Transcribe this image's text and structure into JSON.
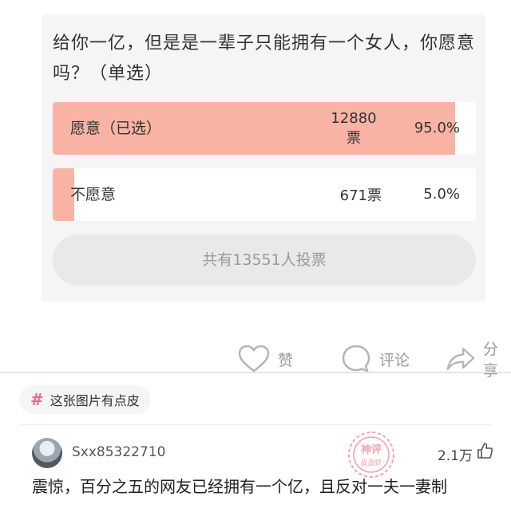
{
  "poll": {
    "question": "给你一亿，但是是一辈子只能拥有一个女人，你愿意吗？（单选）",
    "options": [
      {
        "label": "愿意（已选）",
        "votes": "12880票",
        "percent": "95.0%",
        "fill_fraction": 0.95
      },
      {
        "label": "不愿意",
        "votes": "671票",
        "percent": "5.0%",
        "fill_fraction": 0.05
      }
    ],
    "total": "共有13551人投票"
  },
  "actions": {
    "like_label": "赞",
    "comment_label": "评论",
    "share_label": "分享"
  },
  "tag": {
    "symbol": "#",
    "text": "这张图片有点皮"
  },
  "comment": {
    "username": "Sxx85322710",
    "likes": "2.1万",
    "text": "震惊，百分之五的网友已经拥有一个亿，且反对一夫一妻制"
  },
  "watermark": {
    "text": "神评 皮皮虾"
  },
  "colors": {
    "option_fill": "#f8b3a5",
    "tag_hash": "#f06a85",
    "watermark": "#f4a0ad"
  }
}
